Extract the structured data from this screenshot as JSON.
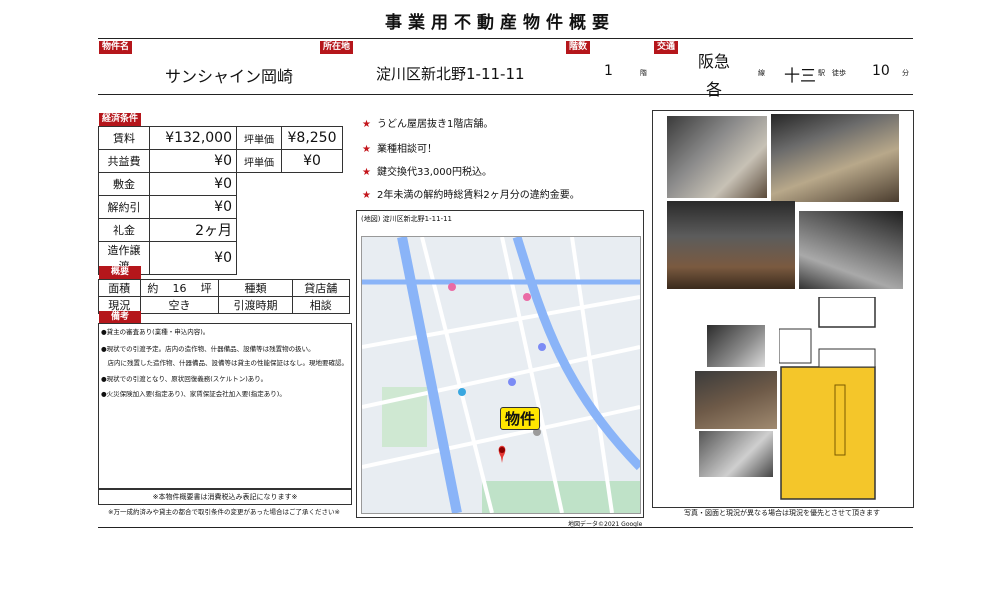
{
  "title": "事業用不動産物件概要",
  "header": {
    "labels": {
      "name": "物件名",
      "address": "所在地",
      "floor": "階数",
      "transit": "交通"
    },
    "property_name": "サンシャイン岡崎",
    "address": "淀川区新北野1-11-11",
    "floor_value": "1",
    "floor_unit": "階",
    "line1": "阪急",
    "line2": "各",
    "line_unit": "線",
    "station": "十三",
    "station_unit": "駅",
    "walk_label": "徒歩",
    "walk_minutes": "10",
    "minute_unit": "分"
  },
  "economic": {
    "label": "経済条件",
    "rows": [
      {
        "label": "賃料",
        "value": "¥132,000",
        "sub_label": "坪単価",
        "sub_value": "¥8,250"
      },
      {
        "label": "共益費",
        "value": "¥0",
        "sub_label": "坪単価",
        "sub_value": "¥0"
      },
      {
        "label": "敷金",
        "value": "¥0"
      },
      {
        "label": "解約引",
        "value": "¥0"
      },
      {
        "label": "礼金",
        "value": "2ヶ月"
      },
      {
        "label": "造作譲渡",
        "value": "¥0"
      }
    ]
  },
  "overview": {
    "label": "概要",
    "row1": {
      "c1": "面積",
      "c2": "約",
      "c3": "16",
      "c4": "坪",
      "c5": "種類",
      "c6": "貸店舗"
    },
    "row2": {
      "c1": "現況",
      "c2": "空き",
      "c3": "引渡時期",
      "c4": "相談"
    }
  },
  "remarks": {
    "label": "備考",
    "lines": [
      "●貸主の審査あり(業種・申込内容)。",
      "●現状での引渡予定。店内の造作物、什器備品、設備等は残置物の扱い。",
      "　店内に残置した造作物、什器備品、設備等は貸主の性能保証はなし。現地要確認。",
      "●現状での引渡となり、原状回復義務(スケルトン)あり。",
      "●火災保険加入要(指定あり)、家賃保証会社加入要(指定あり)。"
    ],
    "footer1": "※本物件概要書は消費税込み表記になります※",
    "footer2": "※万一成約済みや貸主の都合で取引条件の変更があった場合はご了承ください※"
  },
  "features": [
    "うどん屋居抜き1階店舗。",
    "業種相談可！",
    "鍵交換代33,000円税込。",
    "2年未満の解約時総賃料2ヶ月分の違約金要。"
  ],
  "map": {
    "caption": "(地図) 淀川区新北野1-11-11",
    "pin_label": "物件",
    "credit": "地図データ©2021 Google"
  },
  "photos_note": "写真・図面と現況が異なる場合は現況を優先とさせて頂きます",
  "colors": {
    "accent_red": "#b5161b",
    "pin_yellow": "#ffe600",
    "floor_yellow": "#f4c62a"
  }
}
